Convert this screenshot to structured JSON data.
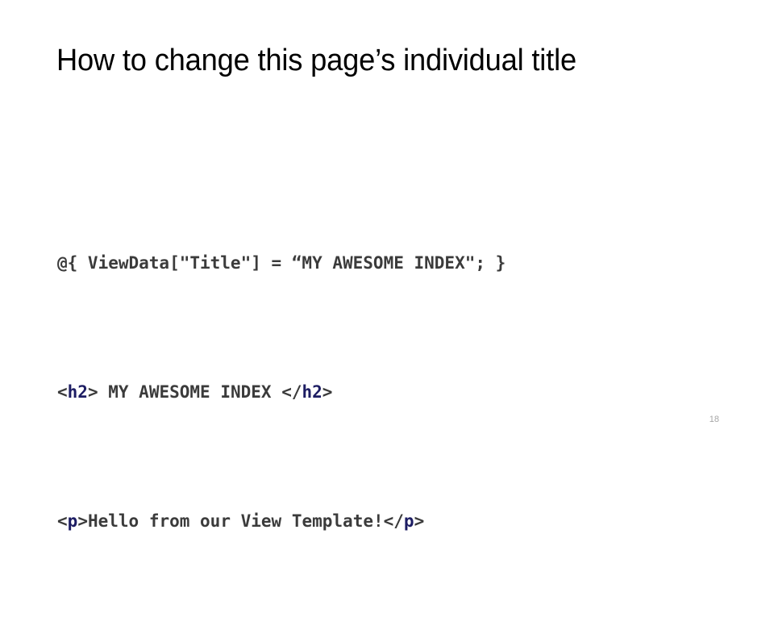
{
  "slide": {
    "title": "How to change this page’s individual title",
    "page_number": "18",
    "background_color": "#ffffff",
    "title_color": "#000000",
    "code_color": "#3b3b3b",
    "tag_color": "#1d1d63",
    "page_number_color": "#a6a6a6"
  },
  "code": {
    "line1": {
      "full": "@{ ViewData[\"Title\"] = “MY AWESOME INDEX\"; }",
      "text": "@{ ViewData[\"Title\"] = “MY AWESOME INDEX\"; }"
    },
    "line2": {
      "full": "<h2> MY AWESOME INDEX </h2>",
      "open_lt": "<",
      "open_tag": "h2",
      "open_gt": "> ",
      "content": "MY AWESOME INDEX",
      "close_lt": " </",
      "close_tag": "h2",
      "close_gt": ">"
    },
    "line3": {
      "full": "<p>Hello from our View Template!</p>",
      "open_lt": "<",
      "open_tag": "p",
      "open_gt": ">",
      "content": "Hello from our View Template!",
      "close_lt": "</",
      "close_tag": "p",
      "close_gt": ">"
    }
  }
}
